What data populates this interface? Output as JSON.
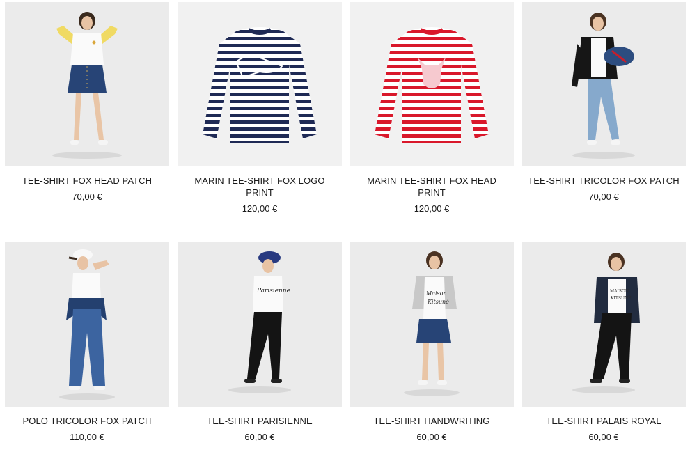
{
  "products": [
    {
      "name": "TEE-SHIRT FOX HEAD PATCH",
      "price": "70,00 €",
      "image": "model-white-tee-denim-skirt-yellow-cardigan"
    },
    {
      "name": "MARIN TEE-SHIRT FOX LOGO PRINT",
      "price": "120,00 €",
      "image": "navy-white-striped-long-sleeve-tee"
    },
    {
      "name": "MARIN TEE-SHIRT FOX HEAD PRINT",
      "price": "120,00 €",
      "image": "red-white-striped-long-sleeve-tee"
    },
    {
      "name": "TEE-SHIRT TRICOLOR FOX PATCH",
      "price": "70,00 €",
      "image": "model-white-tee-black-jacket-light-jeans"
    },
    {
      "name": "POLO TRICOLOR FOX PATCH",
      "price": "110,00 €",
      "image": "model-white-polo-cap-flared-jeans"
    },
    {
      "name": "TEE-SHIRT PARISIENNE",
      "price": "60,00 €",
      "image": "model-parisienne-tee-navy-cap-black-jeans"
    },
    {
      "name": "TEE-SHIRT HANDWRITING",
      "price": "60,00 €",
      "image": "model-handwriting-tee-grey-cardigan-denim-skirt"
    },
    {
      "name": "TEE-SHIRT PALAIS ROYAL",
      "price": "60,00 €",
      "image": "model-palais-royal-tee-denim-jacket-black-jeans"
    }
  ],
  "colors": {
    "navy_stripe": "#1f2a55",
    "red_stripe": "#d9182b",
    "photo_bg": "#ececec",
    "denim": "#2d4d80",
    "light_denim": "#86a9cc"
  }
}
